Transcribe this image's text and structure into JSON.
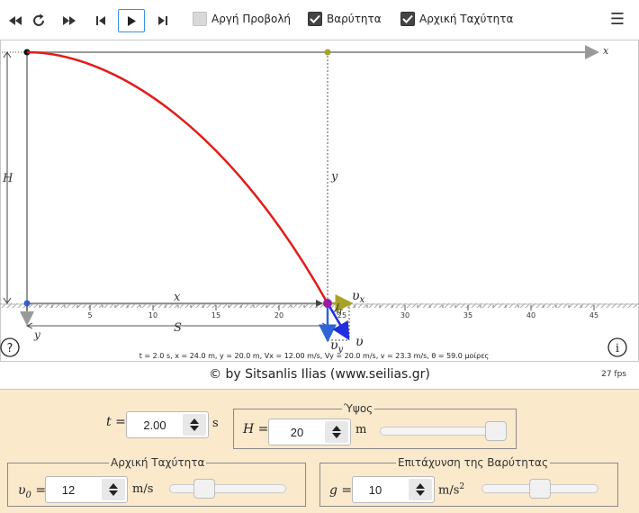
{
  "toolbar": {
    "buttons": [
      "rewind",
      "restart",
      "fast-forward",
      "step-back",
      "play",
      "step-forward"
    ],
    "slow_motion_label": "Αργή Προβολή",
    "slow_motion_checked": false,
    "gravity_label": "Βαρύτητα",
    "gravity_checked": true,
    "initial_velocity_label": "Αρχική Ταχύτητα",
    "initial_velocity_checked": true,
    "menu_icon": "☰"
  },
  "sim": {
    "axis_x": "x",
    "axis_y": "y",
    "label_H": "H",
    "label_y": "y",
    "label_x_ground": "x",
    "label_S": "S",
    "label_y_down": "y",
    "vx_label": "υ",
    "vx_sub": "x",
    "vy_label": "υ",
    "vy_sub": "y",
    "v_label": "υ",
    "theta_label": "θ",
    "ground_ticks": [
      "5",
      "10",
      "15",
      "20",
      "25",
      "30",
      "35",
      "40",
      "45"
    ],
    "status_line": "t = 2.0 s, x = 24.0 m, y = 20.0 m, Vx = 12.00 m/s, Vy = 20.0 m/s, v = 23.3 m/s, θ = 59.0 μοίρες",
    "help_icon": "?",
    "info_icon": "i",
    "colors": {
      "trajectory": "#e31b1b",
      "projectile": "#9b1aa8",
      "vx": "#a7a32a",
      "vy": "#2f63d6",
      "v": "#1f2fe0",
      "axis": "#999999"
    }
  },
  "credit": "© by Sitsanlis Ilias (www.seilias.gr)",
  "fps": "27 fps",
  "controls": {
    "time": {
      "label": "t =",
      "value": "2.00",
      "unit": "s"
    },
    "height": {
      "legend": "Ύψος",
      "label": "H =",
      "value": "20",
      "unit": "m",
      "fraction": 0.92
    },
    "initial_velocity": {
      "legend": "Αρχική Ταχύτητα",
      "label": "υ0 =",
      "label_main": "υ",
      "label_sub": "0",
      "label_eq": " =",
      "value": "12",
      "unit": "m/s",
      "fraction": 0.3
    },
    "gravity": {
      "legend": "Επιτάχυνση της Βαρύτητας",
      "label": "g =",
      "value": "10",
      "unit": "m/s²",
      "unit_main": "m/s",
      "unit_sup": "2",
      "fraction": 0.5
    }
  }
}
